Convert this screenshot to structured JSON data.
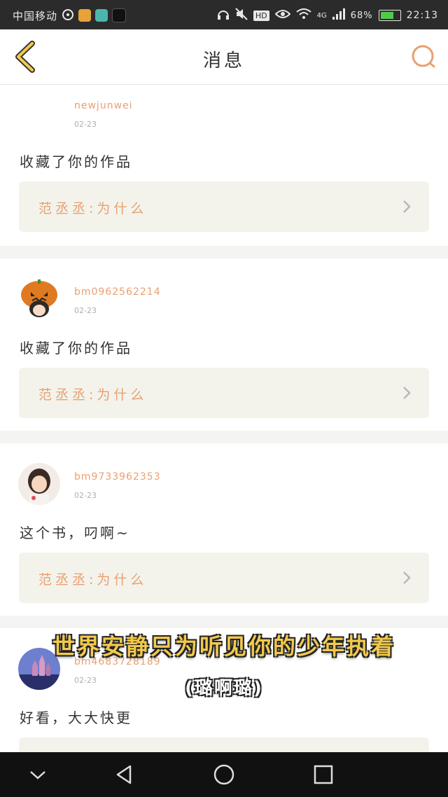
{
  "status_bar": {
    "carrier": "中国移动",
    "badges": [
      "HD",
      "4G"
    ],
    "battery": "68%",
    "time": "22:13",
    "icons": [
      "weibo-icon",
      "weibo-icon",
      "video-app-icon",
      "tiktok-icon",
      "headphone-icon",
      "mute-icon",
      "eye-icon",
      "wifi-icon",
      "signal-icon",
      "battery-icon"
    ]
  },
  "nav": {
    "title": "消息",
    "back_icon": "back-chevron-icon",
    "search_icon": "search-icon",
    "accent": "#e9a070"
  },
  "messages": [
    {
      "username": "newjunwei",
      "date": "02-23",
      "text": "收藏了你的作品",
      "quote": "范丞丞:为什么"
    },
    {
      "username": "bm0962562214",
      "date": "02-23",
      "text": "收藏了你的作品",
      "quote": "范丞丞:为什么"
    },
    {
      "username": "bm9733962353",
      "date": "02-23",
      "text": "这个书，叼啊~",
      "quote": "范丞丞:为什么"
    },
    {
      "username": "bm4683728189",
      "date": "02-23",
      "text": "好看，大大快更",
      "quote": ""
    }
  ],
  "overlay": {
    "line1": "世界安静只为听见你的少年执着",
    "line2": "(璐啊璐)"
  },
  "bottom_nav": [
    "back-triangle-icon",
    "home-circle-icon",
    "recents-square-icon",
    "collapse-chevron-icon"
  ]
}
